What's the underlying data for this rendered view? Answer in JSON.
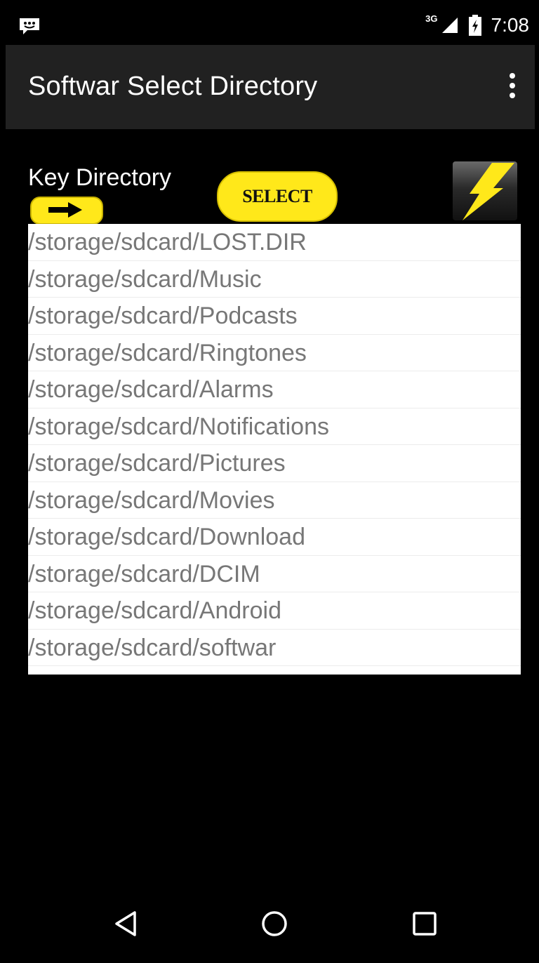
{
  "status_bar": {
    "network_label": "3G",
    "time": "7:08"
  },
  "app_bar": {
    "title": "Softwar Select Directory"
  },
  "controls": {
    "key_label": "Key Directory",
    "select_label": "SELECT"
  },
  "directories": [
    "/storage/sdcard/LOST.DIR",
    "/storage/sdcard/Music",
    "/storage/sdcard/Podcasts",
    "/storage/sdcard/Ringtones",
    "/storage/sdcard/Alarms",
    "/storage/sdcard/Notifications",
    "/storage/sdcard/Pictures",
    "/storage/sdcard/Movies",
    "/storage/sdcard/Download",
    "/storage/sdcard/DCIM",
    "/storage/sdcard/Android",
    "/storage/sdcard/softwar"
  ],
  "colors": {
    "accent_yellow": "#ffe81a",
    "app_bar_bg": "#212121",
    "list_text": "#777777"
  },
  "icons": {
    "status_left": "message-icon",
    "signal": "signal-icon",
    "battery": "battery-charging-icon",
    "overflow": "more-vert-icon",
    "arrow": "arrow-right-icon",
    "bolt": "lightning-bolt-icon",
    "back": "back-icon",
    "home": "home-icon",
    "recents": "recents-icon"
  }
}
